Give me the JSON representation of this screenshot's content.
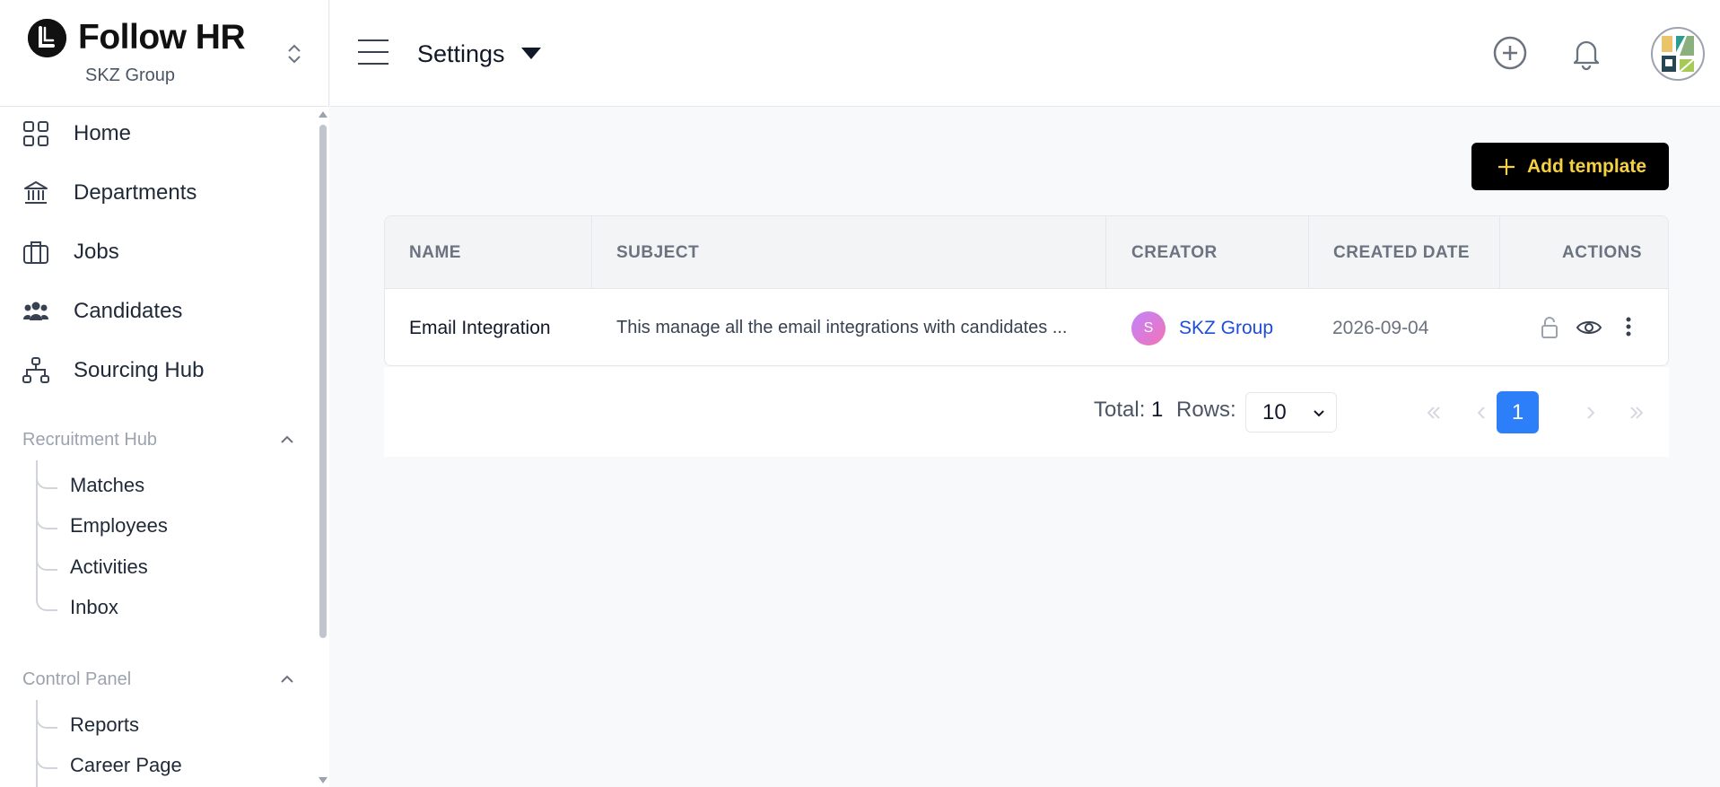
{
  "brand": {
    "name": "Follow HR",
    "org": "SKZ Group"
  },
  "header": {
    "title": "Settings"
  },
  "nav": {
    "items": [
      {
        "label": "Home",
        "icon": "grid-icon"
      },
      {
        "label": "Departments",
        "icon": "bank-icon"
      },
      {
        "label": "Jobs",
        "icon": "briefcase-icon"
      },
      {
        "label": "Candidates",
        "icon": "people-icon"
      },
      {
        "label": "Sourcing Hub",
        "icon": "hierarchy-icon"
      }
    ],
    "recruitment_hub": {
      "label": "Recruitment Hub",
      "items": [
        "Matches",
        "Employees",
        "Activities",
        "Inbox"
      ]
    },
    "control_panel": {
      "label": "Control Panel",
      "items": [
        "Reports",
        "Career Page"
      ]
    }
  },
  "main": {
    "add_button": "Add template",
    "table": {
      "columns": [
        "NAME",
        "SUBJECT",
        "CREATOR",
        "CREATED DATE",
        "ACTIONS"
      ],
      "rows": [
        {
          "name": "Email Integration",
          "subject": "This manage all the email integrations with candidates ...",
          "creator_initial": "S",
          "creator": "SKZ Group",
          "created_date": "2026-09-04"
        }
      ]
    },
    "pagination": {
      "total_label": "Total:",
      "total_value": "1",
      "rows_label": "Rows:",
      "rows_value": "10",
      "current_page": "1"
    }
  },
  "colors": {
    "accent": "#2d7ff9",
    "button_bg": "#000000",
    "button_text": "#f5d142",
    "creator_link": "#1d4ed8"
  }
}
